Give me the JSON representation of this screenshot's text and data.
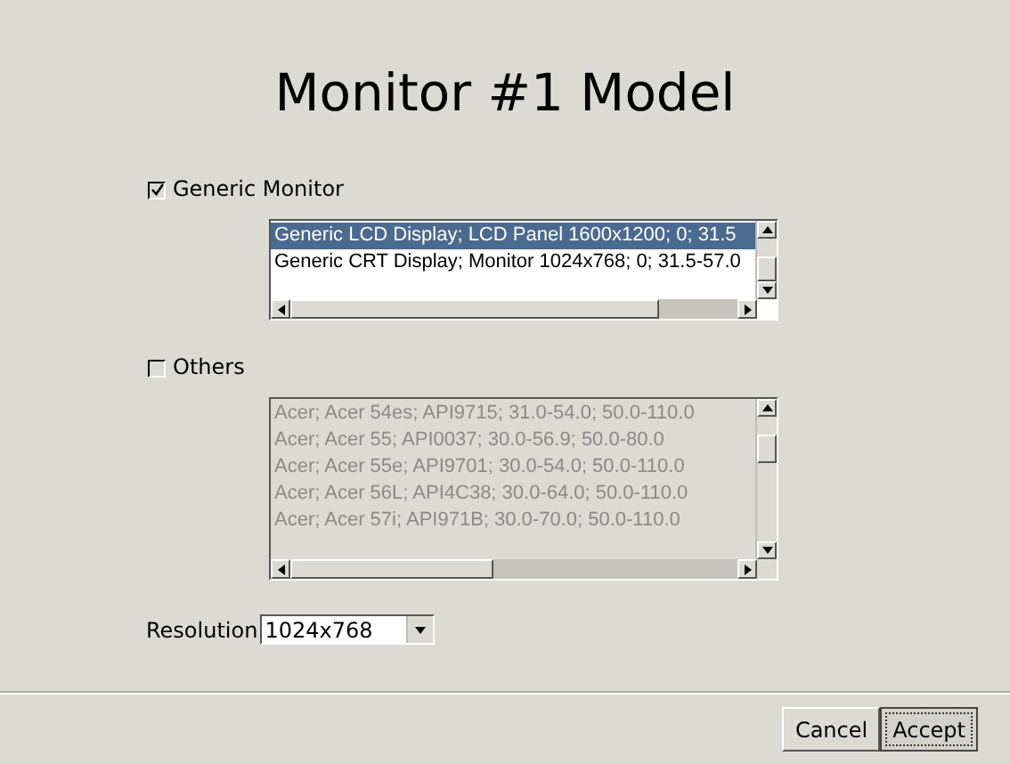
{
  "title": "Monitor #1 Model",
  "generic": {
    "label": "Generic Monitor",
    "checked": true,
    "disabled": false,
    "rows": [
      {
        "text": "Generic LCD Display; LCD Panel 1600x1200; 0; 31.5",
        "selected": true
      },
      {
        "text": "Generic CRT Display; Monitor 1024x768; 0; 31.5-57.0",
        "selected": false
      }
    ]
  },
  "others": {
    "label": "Others",
    "checked": false,
    "disabled": true,
    "rows": [
      {
        "text": "Acer; Acer 54es; API9715; 31.0-54.0; 50.0-110.0",
        "selected": false
      },
      {
        "text": "Acer; Acer 55; API0037; 30.0-56.9; 50.0-80.0",
        "selected": false
      },
      {
        "text": "Acer; Acer 55e; API9701; 30.0-54.0; 50.0-110.0",
        "selected": false
      },
      {
        "text": "Acer; Acer 56L; API4C38; 30.0-64.0; 50.0-110.0",
        "selected": false
      },
      {
        "text": "Acer; Acer 57i; API971B; 30.0-70.0; 50.0-110.0",
        "selected": false
      }
    ]
  },
  "resolution": {
    "label": "Resolution",
    "value": "1024x768"
  },
  "buttons": [
    {
      "label": "Cancel",
      "focused": false
    },
    {
      "label": "Accept",
      "focused": true
    }
  ]
}
